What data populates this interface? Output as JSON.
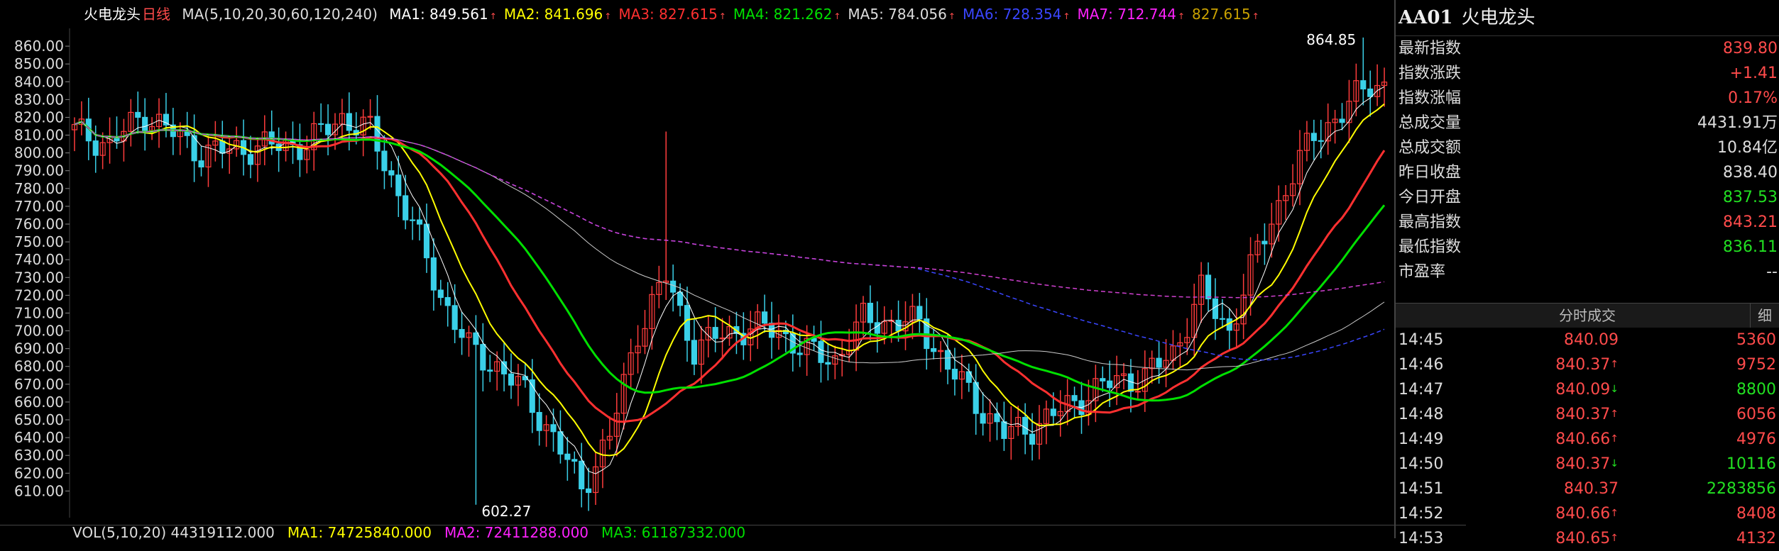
{
  "header": {
    "name": "火电龙头",
    "period": "日线",
    "ma_label": "MA(5,10,20,30,60,120,240)",
    "ma": [
      {
        "text": "MA1: 849.561",
        "color": "#ffffff"
      },
      {
        "text": "MA2: 841.696",
        "color": "#ffff00"
      },
      {
        "text": "MA3: 827.615",
        "color": "#ff3030"
      },
      {
        "text": "MA4: 821.262",
        "color": "#00e000"
      },
      {
        "text": "MA5: 784.056",
        "color": "#dddddd"
      },
      {
        "text": "MA6: 728.354",
        "color": "#3a46ff"
      },
      {
        "text": "MA7: 712.744",
        "color": "#ff22ff"
      },
      {
        "text": "827.615",
        "color": "#c8a000"
      }
    ]
  },
  "volume_header": [
    {
      "text": "VOL(5,10,20) 44319112.000",
      "color": "#dddddd"
    },
    {
      "text": "MA1: 74725840.000",
      "color": "#ffff00"
    },
    {
      "text": "MA2: 72411288.000",
      "color": "#ff22ff"
    },
    {
      "text": "MA3: 61187332.000",
      "color": "#00e000"
    }
  ],
  "chart_data": {
    "type": "candlestick",
    "ylim": [
      595,
      870
    ],
    "y_ticks": [
      "860.00",
      "850.00",
      "840.00",
      "830.00",
      "820.00",
      "810.00",
      "800.00",
      "790.00",
      "780.00",
      "770.00",
      "760.00",
      "750.00",
      "740.00",
      "730.00",
      "720.00",
      "710.00",
      "700.00",
      "690.00",
      "680.00",
      "670.00",
      "660.00",
      "650.00",
      "640.00",
      "630.00",
      "620.00",
      "610.00"
    ],
    "annotations": [
      {
        "text": "864.85",
        "index": 183,
        "value": 864.85
      },
      {
        "text": "602.27",
        "index": 57,
        "value": 602.27
      }
    ],
    "colors": {
      "up": "#ff3c3c",
      "down": "#3ad0e8",
      "ma1": "#ffffff",
      "ma2": "#ffff00",
      "ma3": "#ff3030",
      "ma4": "#00e000",
      "ma5": "#cccccc",
      "ma6": "#3a46ff",
      "ma7": "#d040d0"
    }
  },
  "quote": {
    "code": "AA01",
    "name": "火电龙头",
    "rows": [
      {
        "label": "最新指数",
        "value": "839.80",
        "color": "#ff4b4b"
      },
      {
        "label": "指数涨跌",
        "value": "+1.41",
        "color": "#ff4b4b"
      },
      {
        "label": "指数涨幅",
        "value": "0.17%",
        "color": "#ff4b4b"
      },
      {
        "label": "总成交量",
        "value": "4431.91万",
        "color": "#dddddd"
      },
      {
        "label": "总成交额",
        "value": "10.84亿",
        "color": "#dddddd"
      },
      {
        "label": "昨日收盘",
        "value": "838.40",
        "color": "#dddddd"
      },
      {
        "label": "今日开盘",
        "value": "837.53",
        "color": "#22e022"
      },
      {
        "label": "最高指数",
        "value": "843.21",
        "color": "#ff4b4b"
      },
      {
        "label": "最低指数",
        "value": "836.11",
        "color": "#22e022"
      },
      {
        "label": "市盈率",
        "value": "--",
        "color": "#dddddd"
      }
    ]
  },
  "ticks_section": {
    "title": "分时成交",
    "toggle": "细",
    "rows": [
      {
        "time": "14:45",
        "price": "840.09",
        "arrow": "",
        "vol": "5360",
        "pc": "#ff4b4b",
        "vc": "#ff4b4b"
      },
      {
        "time": "14:46",
        "price": "840.37",
        "arrow": "↑",
        "vol": "9752",
        "pc": "#ff4b4b",
        "vc": "#ff4b4b"
      },
      {
        "time": "14:47",
        "price": "840.09",
        "arrow": "↓",
        "vol": "8800",
        "pc": "#ff4b4b",
        "vc": "#22e022"
      },
      {
        "time": "14:48",
        "price": "840.37",
        "arrow": "↑",
        "vol": "6056",
        "pc": "#ff4b4b",
        "vc": "#ff4b4b"
      },
      {
        "time": "14:49",
        "price": "840.66",
        "arrow": "↑",
        "vol": "4976",
        "pc": "#ff4b4b",
        "vc": "#ff4b4b"
      },
      {
        "time": "14:50",
        "price": "840.37",
        "arrow": "↓",
        "vol": "10116",
        "pc": "#ff4b4b",
        "vc": "#22e022"
      },
      {
        "time": "14:51",
        "price": "840.37",
        "arrow": "",
        "vol": "2283856",
        "pc": "#ff4b4b",
        "vc": "#22e022"
      },
      {
        "time": "14:52",
        "price": "840.66",
        "arrow": "↑",
        "vol": "8408",
        "pc": "#ff4b4b",
        "vc": "#ff4b4b"
      },
      {
        "time": "14:53",
        "price": "840.65",
        "arrow": "↑",
        "vol": "4132",
        "pc": "#ff4b4b",
        "vc": "#ff4b4b"
      }
    ]
  }
}
